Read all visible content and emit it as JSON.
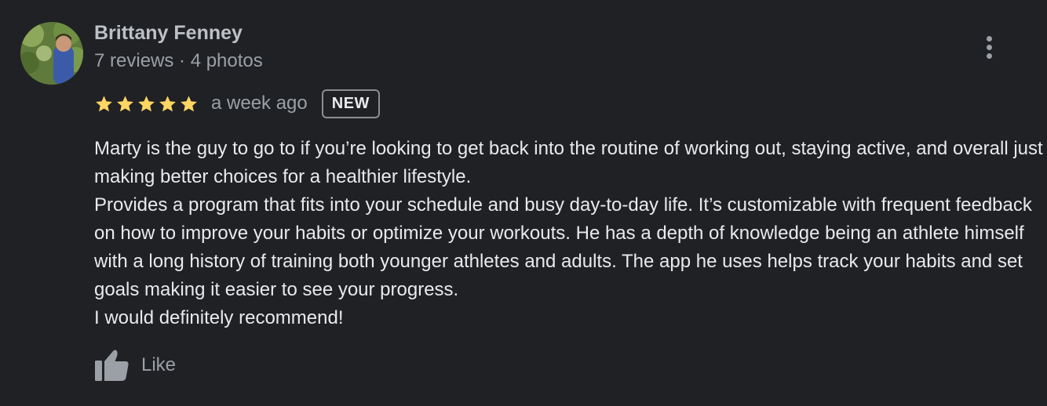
{
  "author": {
    "name": "Brittany Fenney",
    "meta": "7 reviews · 4 photos",
    "avatar_icon": "profile-photo"
  },
  "menu": {
    "icon": "more-vertical-icon"
  },
  "rating": {
    "stars": 5,
    "max_stars": 5,
    "star_color": "#fdd663"
  },
  "date": "a week ago",
  "badge": "NEW",
  "review": {
    "paragraphs": [
      "Marty is the guy to go to if you’re looking to get back into the routine of working out, staying active, and overall just making better choices for a healthier lifestyle.",
      "Provides a program that fits into your schedule and busy day-to-day life. It’s customizable with frequent feedback on how to improve your habits or optimize your workouts. He has a depth of knowledge being an athlete himself with a long history of training both younger athletes and adults. The app he uses helps track your habits and set goals making it easier to see your progress.",
      "I would definitely recommend!"
    ]
  },
  "actions": {
    "like_label": "Like",
    "like_icon": "thumbs-up-icon"
  },
  "colors": {
    "background": "#202124",
    "text_primary": "#e8eaed",
    "text_secondary": "#9aa0a6"
  }
}
